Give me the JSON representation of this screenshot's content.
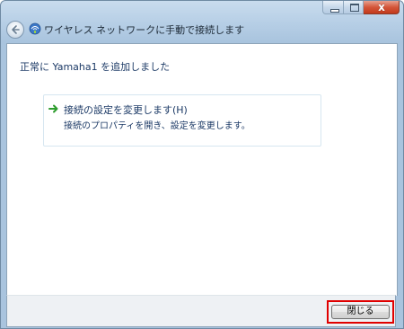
{
  "window": {
    "title": "ワイヤレス ネットワークに手動で接続します",
    "caption": {
      "close_glyph": "x"
    }
  },
  "content": {
    "success_message": "正常に Yamaha1 を追加しました",
    "options": [
      {
        "title": "接続の設定を変更します(H)",
        "description": "接続のプロパティを開き、設定を変更します。",
        "icon": "green-arrow-icon"
      }
    ]
  },
  "footer": {
    "close_label": "閉じる",
    "highlight_color": "#e00000"
  },
  "colors": {
    "title_text": "#1e2b38",
    "content_text": "#1c3a66",
    "arrow": "#2e9d2e"
  }
}
